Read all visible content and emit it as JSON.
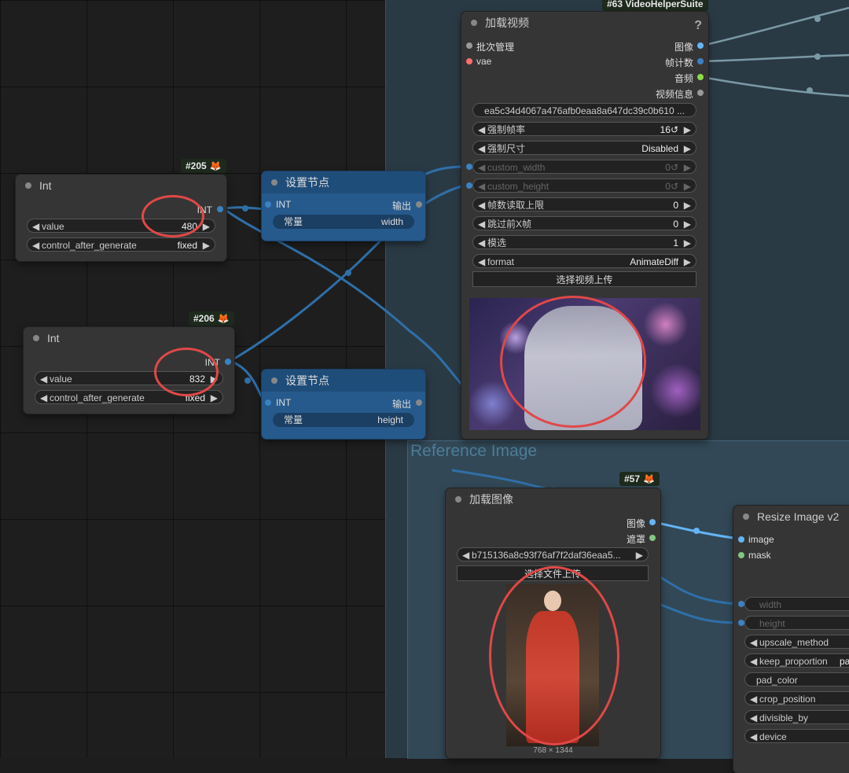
{
  "colors": {
    "slot_int": "#3b82c4",
    "slot_image": "#64b5f6",
    "slot_mask": "#81c784",
    "slot_vae": "#ff6e6e",
    "slot_audio": "#88dd44",
    "highlight_circle": "#e04848"
  },
  "node205": {
    "badge": "#205",
    "title": "Int",
    "output": "INT",
    "value_label": "value",
    "value": "480",
    "cag_label": "control_after_generate",
    "cag_value": "fixed"
  },
  "node206": {
    "badge": "#206",
    "title": "Int",
    "output": "INT",
    "value_label": "value",
    "value": "832",
    "cag_label": "control_after_generate",
    "cag_value": "fixed"
  },
  "setnode1": {
    "title": "设置节点",
    "input": "INT",
    "output": "输出",
    "const_label": "常量",
    "const_value": "width"
  },
  "setnode2": {
    "title": "设置节点",
    "input": "INT",
    "output": "输出",
    "const_label": "常量",
    "const_value": "height"
  },
  "node63": {
    "badge": "#63 VideoHelperSuite",
    "title": "加载视频",
    "help": "?",
    "inputs": [
      "批次管理",
      "vae"
    ],
    "outputs": [
      "图像",
      "帧计数",
      "音频",
      "视频信息"
    ],
    "file": "ea5c34d4067a476afb0eaa8a647dc39c0b610 ...",
    "widgets": [
      {
        "label": "强制帧率",
        "value": "16↺"
      },
      {
        "label": "强制尺寸",
        "value": "Disabled"
      },
      {
        "label": "custom_width",
        "value": "0↺"
      },
      {
        "label": "custom_height",
        "value": "0↺"
      },
      {
        "label": "帧数读取上限",
        "value": "0"
      },
      {
        "label": "跳过前X帧",
        "value": "0"
      },
      {
        "label": "模选",
        "value": "1"
      },
      {
        "label": "format",
        "value": "AnimateDiff"
      }
    ],
    "upload": "选择视频上传"
  },
  "group_ref": {
    "title": "Reference Image"
  },
  "node57": {
    "badge": "#57",
    "title": "加载图像",
    "outputs": [
      "图像",
      "遮罩"
    ],
    "file": "b715136a8c93f76af7f2daf36eaa5...",
    "upload": "选择文件上传",
    "dims": "768 × 1344"
  },
  "resize": {
    "title": "Resize Image v2",
    "inputs": [
      "image",
      "mask"
    ],
    "widgets": [
      "width",
      "height",
      "upscale_method",
      "keep_proportion",
      "pad_color",
      "crop_position",
      "divisible_by",
      "device"
    ],
    "keep_value": "pa"
  }
}
